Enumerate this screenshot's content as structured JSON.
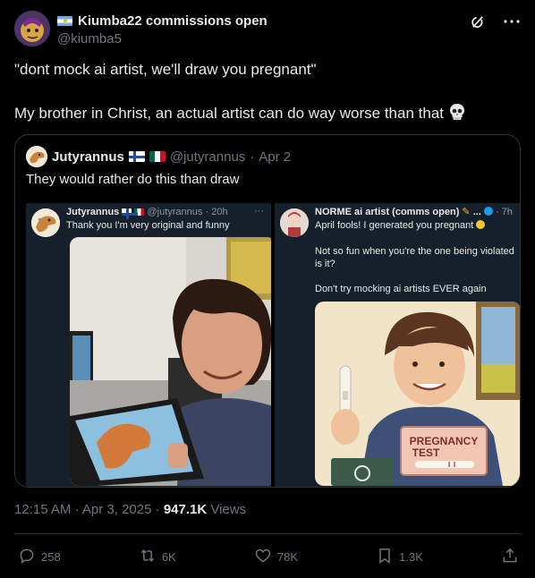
{
  "author": {
    "display_name": "Kiumba22 commissions open",
    "handle": "@kiumba5"
  },
  "tweet": {
    "line1": "\"dont mock ai artist, we'll draw you pregnant\"",
    "line2": "My brother in Christ, an actual artist can do way worse than that"
  },
  "quote": {
    "name": "Jutyrannus",
    "handle": "@jutyrannus",
    "sep": "·",
    "date": "Apr 2",
    "text": "They would rather do this than draw",
    "left_panel": {
      "name": "Jutyrannus",
      "handle": "@jutyrannus",
      "sep": "·",
      "time": "20h",
      "text": "Thank you I'm very original and funny"
    },
    "right_panel": {
      "name": "NORME ai artist (comms open)",
      "ellipsis": "...",
      "sep": "·",
      "time": "7h",
      "line1": "April fools! I generated you pregnant",
      "line2": "Not so fun when you're the one being violated is it?",
      "line3": "Don't try mocking ai artists EVER again",
      "sign_line1": "PREGNANCY",
      "sign_line2": "TEST"
    }
  },
  "meta": {
    "time": "12:15 AM",
    "sep": "·",
    "date": "Apr 3, 2025",
    "sep2": "·",
    "views_count": "947.1K",
    "views_label": "Views"
  },
  "actions": {
    "replies": "258",
    "reposts": "6K",
    "likes": "78K",
    "bookmarks": "1.3K"
  },
  "colors": {
    "background": "#000000",
    "text": "#e7e9ea",
    "muted": "#71767b",
    "border": "#2f3336",
    "panel": "#15202b"
  }
}
